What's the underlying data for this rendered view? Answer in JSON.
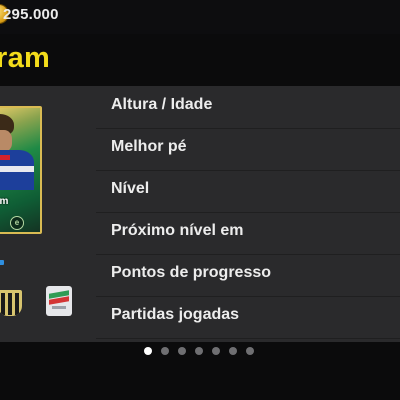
{
  "header": {
    "coin_amount": "295.000",
    "coin_icon": "gold-coin-icon",
    "player_name_partial": "ram"
  },
  "card": {
    "name_partial": "ram",
    "logo_glyph": "e"
  },
  "stats": [
    {
      "label": "Altura / Idade"
    },
    {
      "label": "Melhor pé"
    },
    {
      "label": "Nível"
    },
    {
      "label": "Próximo nível em"
    },
    {
      "label": "Pontos de progresso"
    },
    {
      "label": "Partidas jogadas"
    }
  ],
  "pager": {
    "total": 7,
    "active_index": 0
  },
  "colors": {
    "name_yellow": "#f3dc1b",
    "panel_bg": "#2a2a2c",
    "page_bg": "#0b0b0c"
  }
}
